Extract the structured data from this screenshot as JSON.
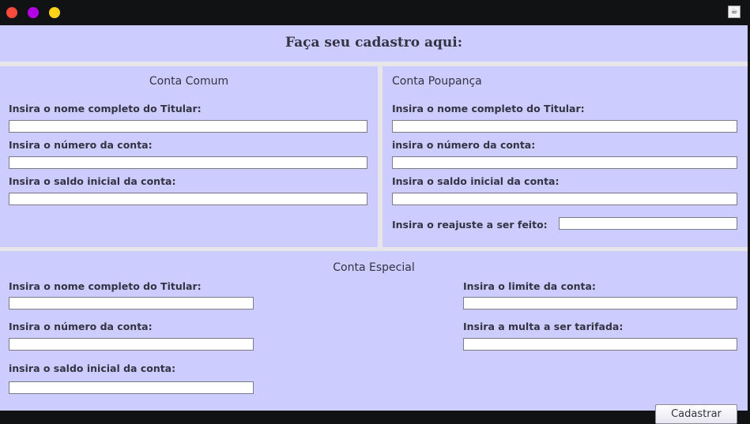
{
  "window": {
    "icon": "java-app-icon"
  },
  "colors": {
    "panel": "#ccccff",
    "titlebar": "#111214",
    "close": "#ff4a3d",
    "minimize": "#b400e6",
    "maximize": "#ffd21a"
  },
  "header": {
    "title": "Faça seu cadastro aqui:"
  },
  "comum": {
    "title": "Conta Comum",
    "nome_label": "Insira o nome completo do Titular:",
    "numero_label": "Insira o número da conta:",
    "saldo_label": "Insira o saldo inicial da conta:",
    "nome_value": "",
    "numero_value": "",
    "saldo_value": ""
  },
  "poupanca": {
    "title": "Conta Poupança",
    "nome_label": "Insira o nome completo do Titular:",
    "numero_label": "insira o número da conta:",
    "saldo_label": "Insira o saldo inicial da conta:",
    "reajuste_label": "Insira o reajuste a ser feito:",
    "nome_value": "",
    "numero_value": "",
    "saldo_value": "",
    "reajuste_value": ""
  },
  "especial": {
    "title": "Conta Especial",
    "nome_label": "Insira o nome completo do Titular:",
    "numero_label": "Insira o número da conta:",
    "saldo_label": "insira o saldo inicial da conta:",
    "limite_label": "Insira o limite da conta:",
    "multa_label": "Insira a multa a ser tarifada:",
    "nome_value": "",
    "numero_value": "",
    "saldo_value": "",
    "limite_value": "",
    "multa_value": ""
  },
  "actions": {
    "cadastrar_label": "Cadastrar"
  }
}
